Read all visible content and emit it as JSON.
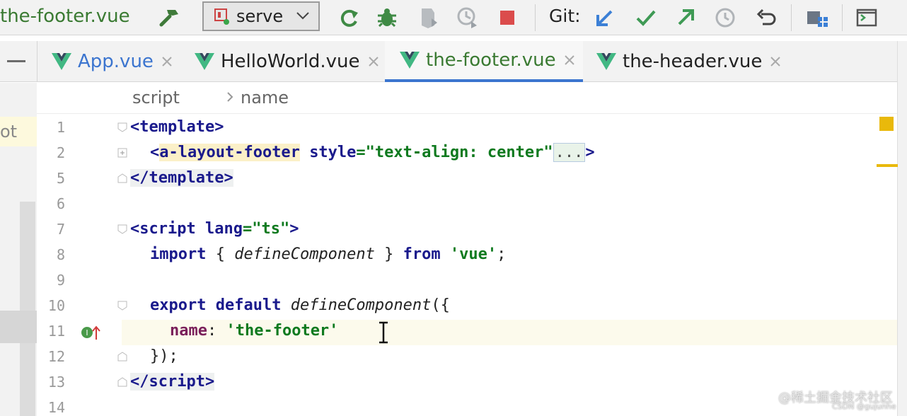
{
  "toolbar": {
    "file_title": "the-footer.vue",
    "run_config": {
      "label": "serve"
    },
    "git_label": "Git:"
  },
  "tabs": [
    {
      "label": "App.vue",
      "active": false
    },
    {
      "label": "HelloWorld.vue",
      "active": false
    },
    {
      "label": "the-footer.vue",
      "active": true
    },
    {
      "label": "the-header.vue",
      "active": false
    }
  ],
  "project_panel": {
    "visible_text": "ot"
  },
  "breadcrumb": {
    "items": [
      "script",
      "name"
    ]
  },
  "editor": {
    "line_numbers": [
      "1",
      "2",
      "5",
      "6",
      "7",
      "8",
      "9",
      "10",
      "11",
      "12",
      "13",
      "14"
    ],
    "lines": {
      "l1": {
        "open": "<",
        "tag": "template",
        "close": ">"
      },
      "l2": {
        "open": "<",
        "tag": "a-layout-footer",
        "attr": "style",
        "eq": "=",
        "value": "\"text-align: center\"",
        "folded": "...",
        "close": ">"
      },
      "l5": {
        "open": "</",
        "tag": "template",
        "close": ">"
      },
      "l7": {
        "open": "<",
        "tag": "script",
        "attr": "lang",
        "eq": "=",
        "value": "\"ts\"",
        "close": ">"
      },
      "l8": {
        "kw1": "import",
        "brace_open": " { ",
        "fn": "defineComponent",
        "brace_close": " } ",
        "kw2": "from",
        "sp": " ",
        "str": "'vue'",
        "semi": ";"
      },
      "l10": {
        "kw1": "export",
        "sp1": " ",
        "kw2": "default",
        "sp2": " ",
        "fn": "defineComponent",
        "rest": "({"
      },
      "l11": {
        "prop": "name",
        "colon": ": ",
        "str": "'the-footer'"
      },
      "l12": {
        "text": "});"
      },
      "l13": {
        "open": "</",
        "tag": "script",
        "close": ">"
      }
    }
  },
  "watermark": {
    "text": "@稀土掘金技术社区",
    "sub": "CSDN @gujunhe"
  },
  "colors": {
    "accent_green": "#3a7a32",
    "accent_blue": "#3c75cf",
    "keyword": "#1a1a8c",
    "string": "#0f7a1f",
    "property": "#7a1f5a",
    "warning": "#e9b90b"
  }
}
